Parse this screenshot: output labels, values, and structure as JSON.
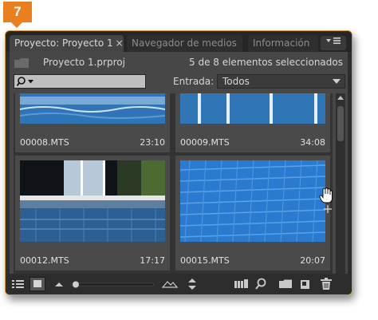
{
  "step_badge": "7",
  "tabs": [
    {
      "label": "Proyecto: Proyecto 1",
      "close": "×",
      "active": true
    },
    {
      "label": "Navegador de medios",
      "active": false
    },
    {
      "label": "Información",
      "active": false
    }
  ],
  "panel_menu_icon": "panel-menu-icon",
  "project": {
    "file_name": "Proyecto 1.prproj",
    "selection_status": "5 de 8 elementos seleccionados"
  },
  "search": {
    "value": "",
    "icon": "search-icon"
  },
  "entrada": {
    "label": "Entrada:",
    "selected": "Todos"
  },
  "clips": [
    {
      "name": "00008.MTS",
      "duration": "23:10"
    },
    {
      "name": "00009.MTS",
      "duration": "34:08"
    },
    {
      "name": "00012.MTS",
      "duration": "17:17"
    },
    {
      "name": "00015.MTS",
      "duration": "20:07"
    }
  ],
  "bottom_toolbar": {
    "icons": [
      "list-view-icon",
      "icon-view-icon",
      "zoom-out-icon",
      "zoom-slider",
      "zoom-in-icon",
      "sort-icon",
      "automate-to-sequence-icon",
      "find-icon",
      "new-bin-icon",
      "new-item-icon",
      "clear-icon"
    ]
  },
  "colors": {
    "accent": "#ea7f1f",
    "panel_border": "#d89a2b",
    "selected_clip_border": "#e0e0e0"
  }
}
